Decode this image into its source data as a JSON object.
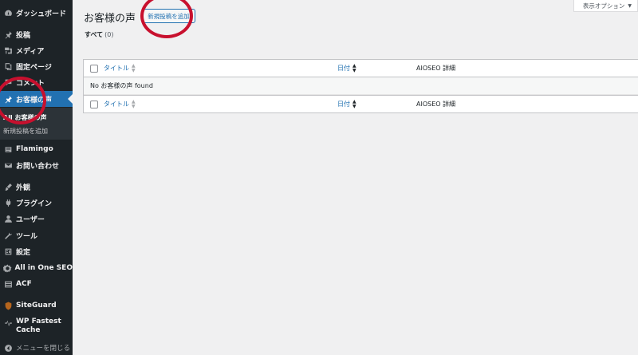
{
  "sidebar": {
    "items": [
      {
        "label": "ダッシュボード",
        "icon": "dashboard-icon"
      },
      {
        "label": "投稿",
        "icon": "pin-icon"
      },
      {
        "label": "メディア",
        "icon": "media-icon"
      },
      {
        "label": "固定ページ",
        "icon": "page-icon"
      },
      {
        "label": "コメント",
        "icon": "comment-icon"
      },
      {
        "label": "お客様の声",
        "icon": "pin-icon"
      },
      {
        "label": "Flamingo",
        "icon": "flamingo-icon"
      },
      {
        "label": "お問い合わせ",
        "icon": "mail-icon"
      },
      {
        "label": "外観",
        "icon": "brush-icon"
      },
      {
        "label": "プラグイン",
        "icon": "plugin-icon"
      },
      {
        "label": "ユーザー",
        "icon": "user-icon"
      },
      {
        "label": "ツール",
        "icon": "wrench-icon"
      },
      {
        "label": "設定",
        "icon": "settings-icon"
      },
      {
        "label": "All in One SEO",
        "icon": "aioseo-icon"
      },
      {
        "label": "ACF",
        "icon": "acf-icon"
      },
      {
        "label": "SiteGuard",
        "icon": "siteguard-icon"
      },
      {
        "label": "WP Fastest Cache",
        "icon": "cache-icon"
      }
    ],
    "submenu": {
      "all": "All お客様の声",
      "add_new": "新規投稿を追加"
    },
    "collapse": "メニューを閉じる"
  },
  "header": {
    "title": "お客様の声",
    "add_new_button": "新規投稿を追加",
    "screen_options": "表示オプション"
  },
  "filters": {
    "all_label": "すべて",
    "all_count": "(0)"
  },
  "table": {
    "columns": {
      "title": "タイトル",
      "date": "日付",
      "seo": "AIOSEO 詳細"
    },
    "empty_message": "No お客様の声 found"
  },
  "colors": {
    "sidebar_bg": "#1d2327",
    "accent": "#2271b1",
    "annotation": "#c8102e"
  }
}
